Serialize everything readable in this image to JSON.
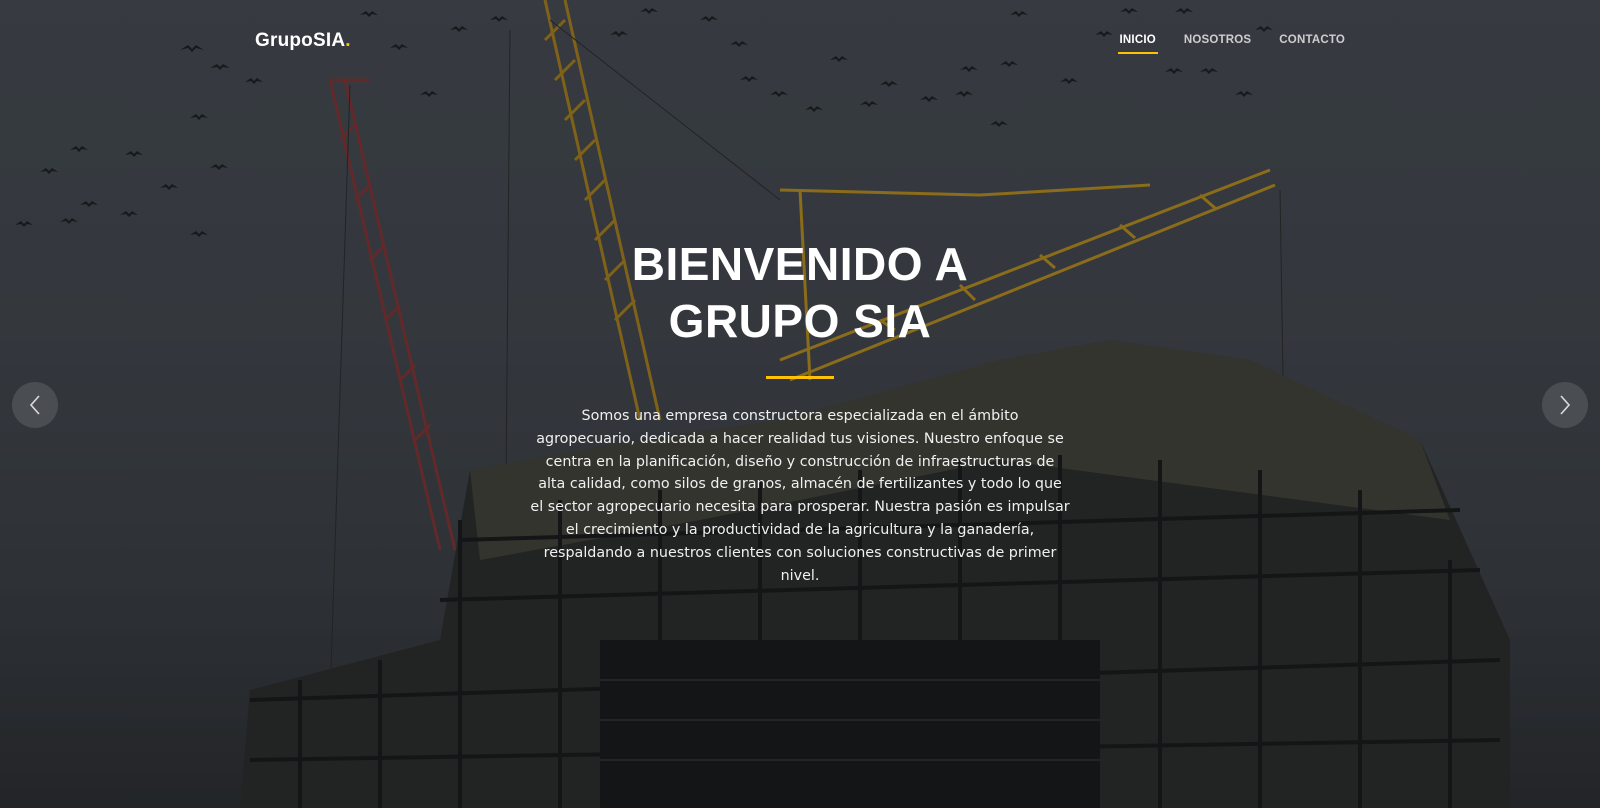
{
  "header": {
    "logo_text": "GrupoSIA",
    "logo_dot": ".",
    "nav": [
      {
        "label": "INICIO",
        "active": true
      },
      {
        "label": "NOSOTROS",
        "active": false
      },
      {
        "label": "CONTACTO",
        "active": false
      }
    ]
  },
  "hero": {
    "title_line1": "BIENVENIDO A",
    "title_line2": "GRUPO SIA",
    "description": "Somos una empresa constructora especializada en el ámbito agropecuario, dedicada a hacer realidad tus visiones. Nuestro enfoque se centra en la planificación, diseño y construcción de infraestructuras de alta calidad, como silos de granos, almacén de fertilizantes y todo lo que el sector agropecuario necesita para prosperar. Nuestra pasión es impulsar el crecimiento y la productividad de la agricultura y la ganadería, respaldando a nuestros clientes con soluciones constructivas de primer nivel."
  },
  "carousel": {
    "prev_icon": "chevron-left-icon",
    "next_icon": "chevron-right-icon"
  },
  "colors": {
    "accent": "#ffc107",
    "crane_yellow": "#c99a1c",
    "crane_red": "#9b3a3a"
  }
}
